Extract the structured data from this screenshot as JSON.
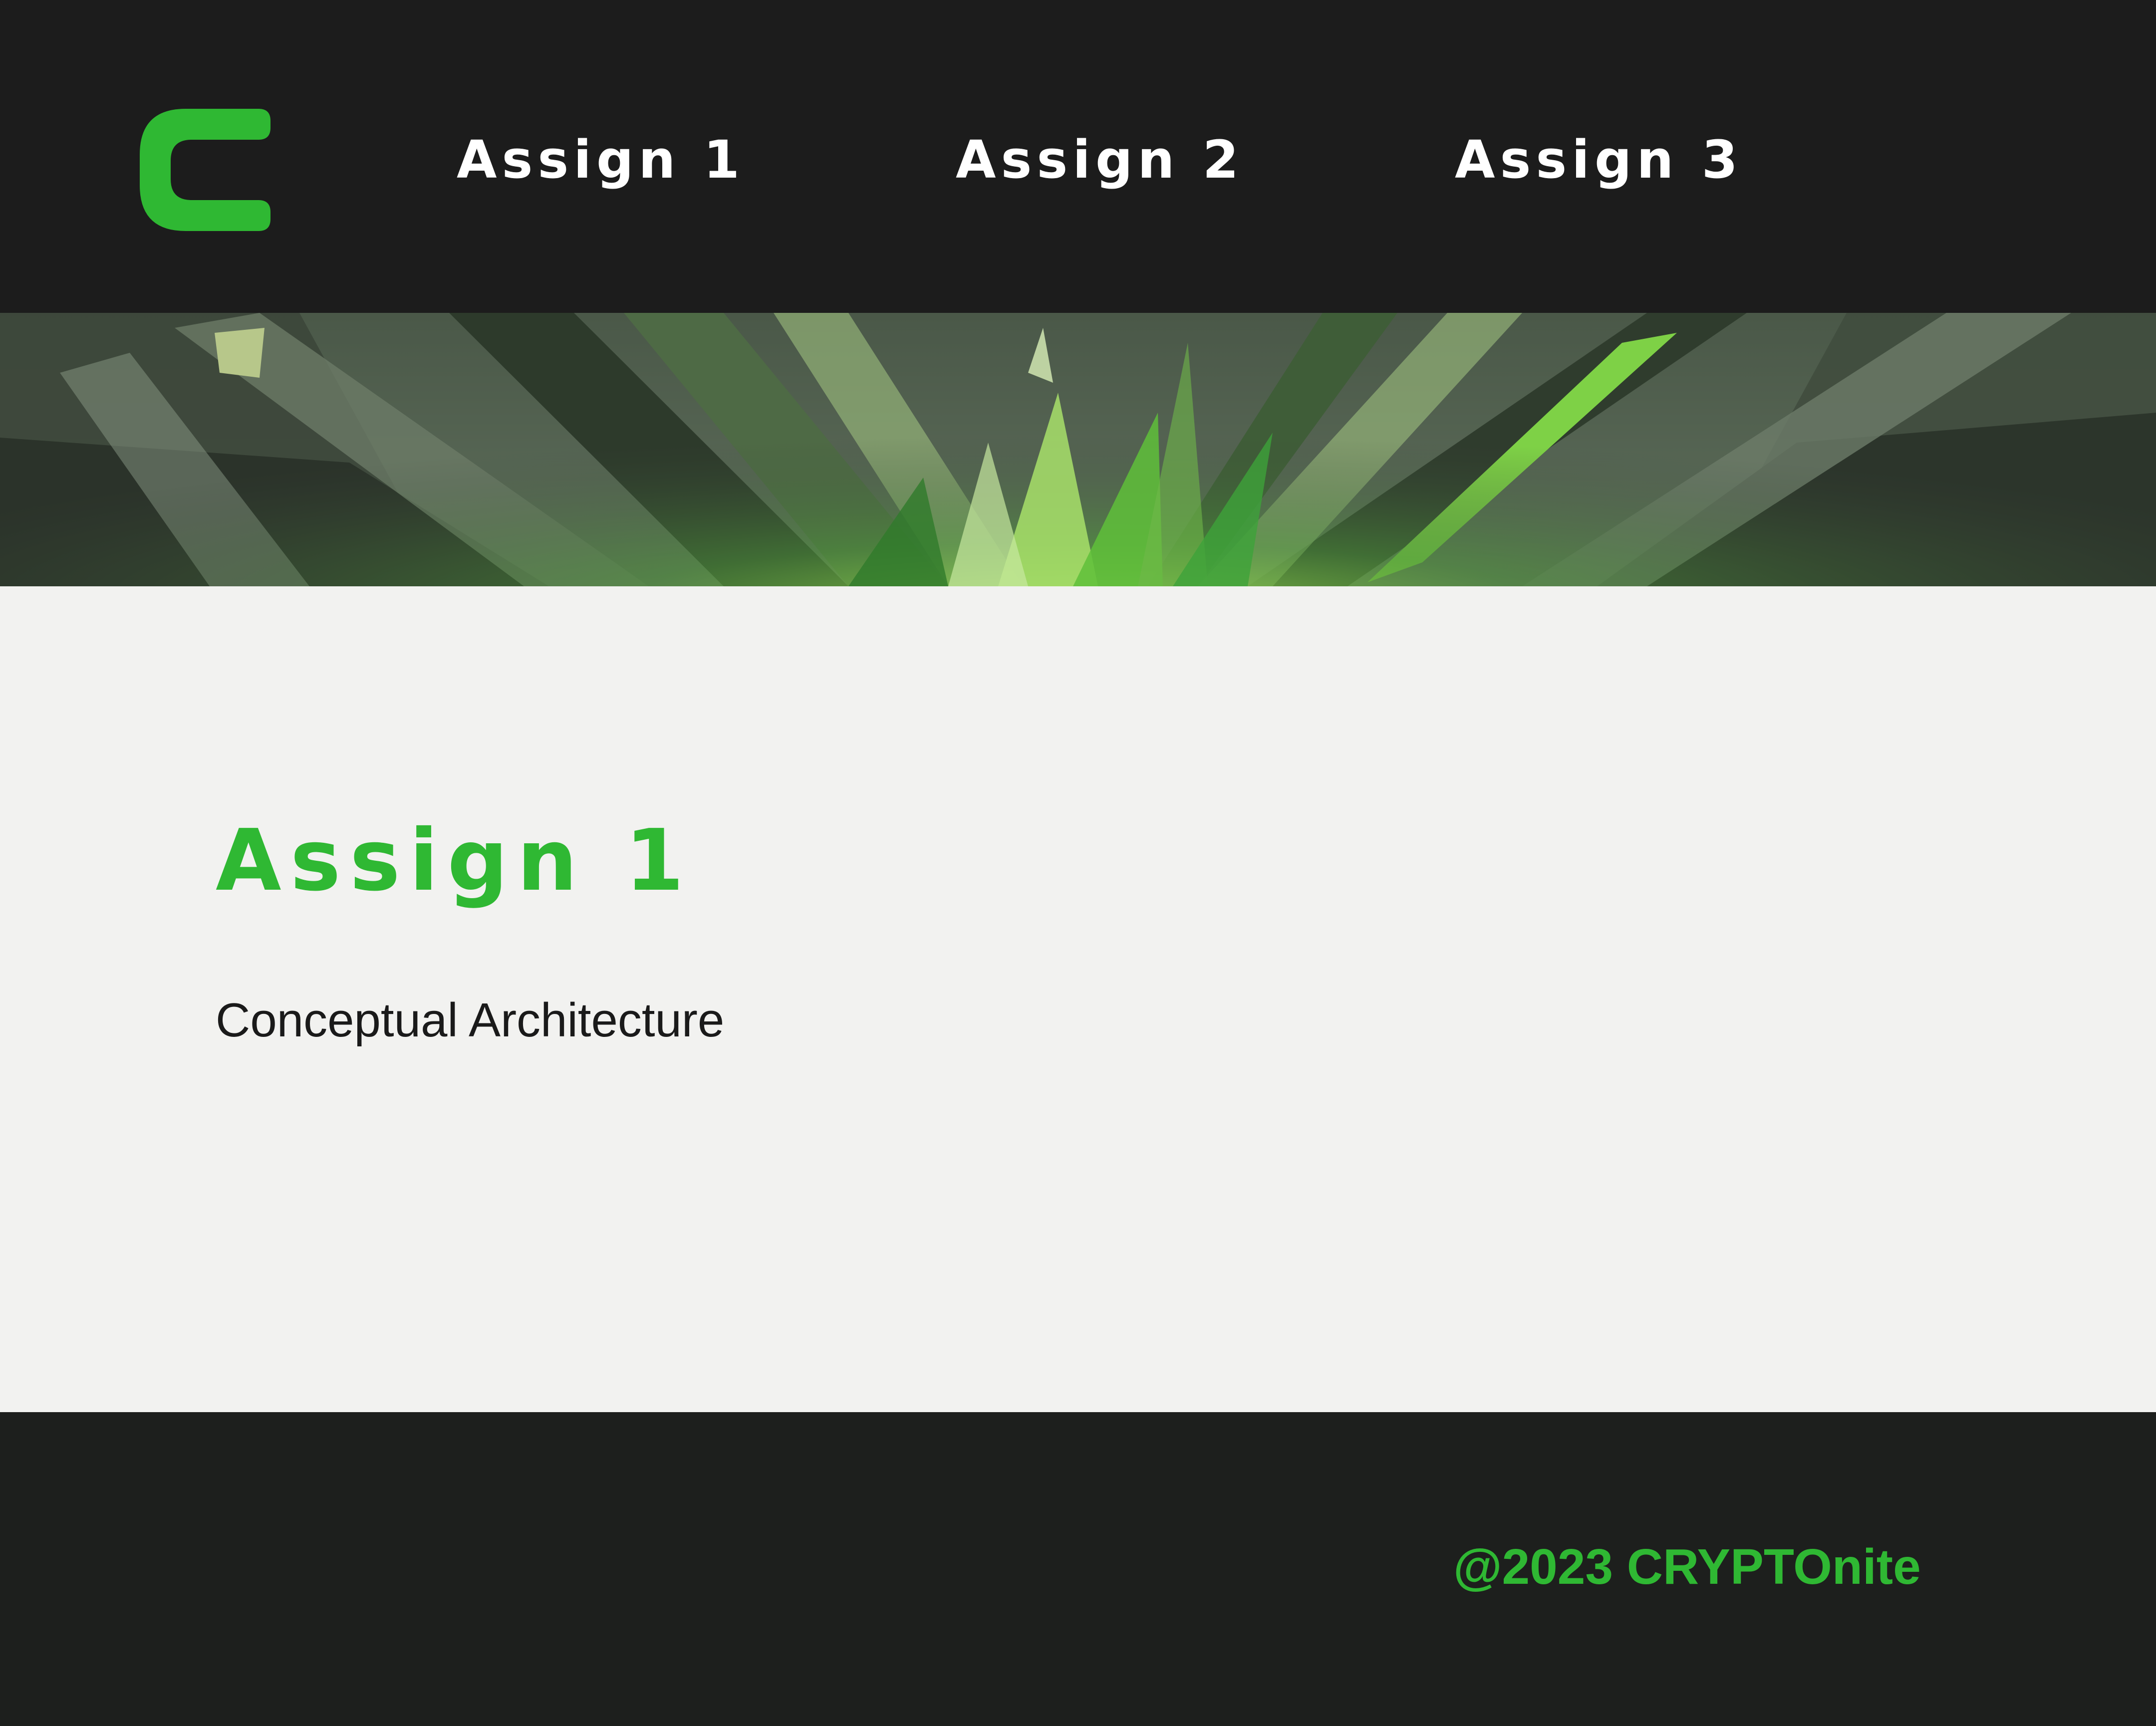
{
  "header": {
    "logo_icon": "crypto-c-logo-icon",
    "nav": [
      {
        "label": "Assign 1"
      },
      {
        "label": "Assign 2"
      },
      {
        "label": "Assign 3"
      }
    ]
  },
  "hero": {
    "image": "green-crystal-shards-banner"
  },
  "main": {
    "title": "Assign 1",
    "subtitle": "Conceptual Architecture"
  },
  "footer": {
    "copyright": "@2023 CRYPTOnite"
  },
  "colors": {
    "dark_background": "#1c1c1c",
    "accent_green": "#2fb833",
    "content_background": "#f2f2f0",
    "nav_text": "#ffffff",
    "body_text": "#1a1a1a"
  }
}
